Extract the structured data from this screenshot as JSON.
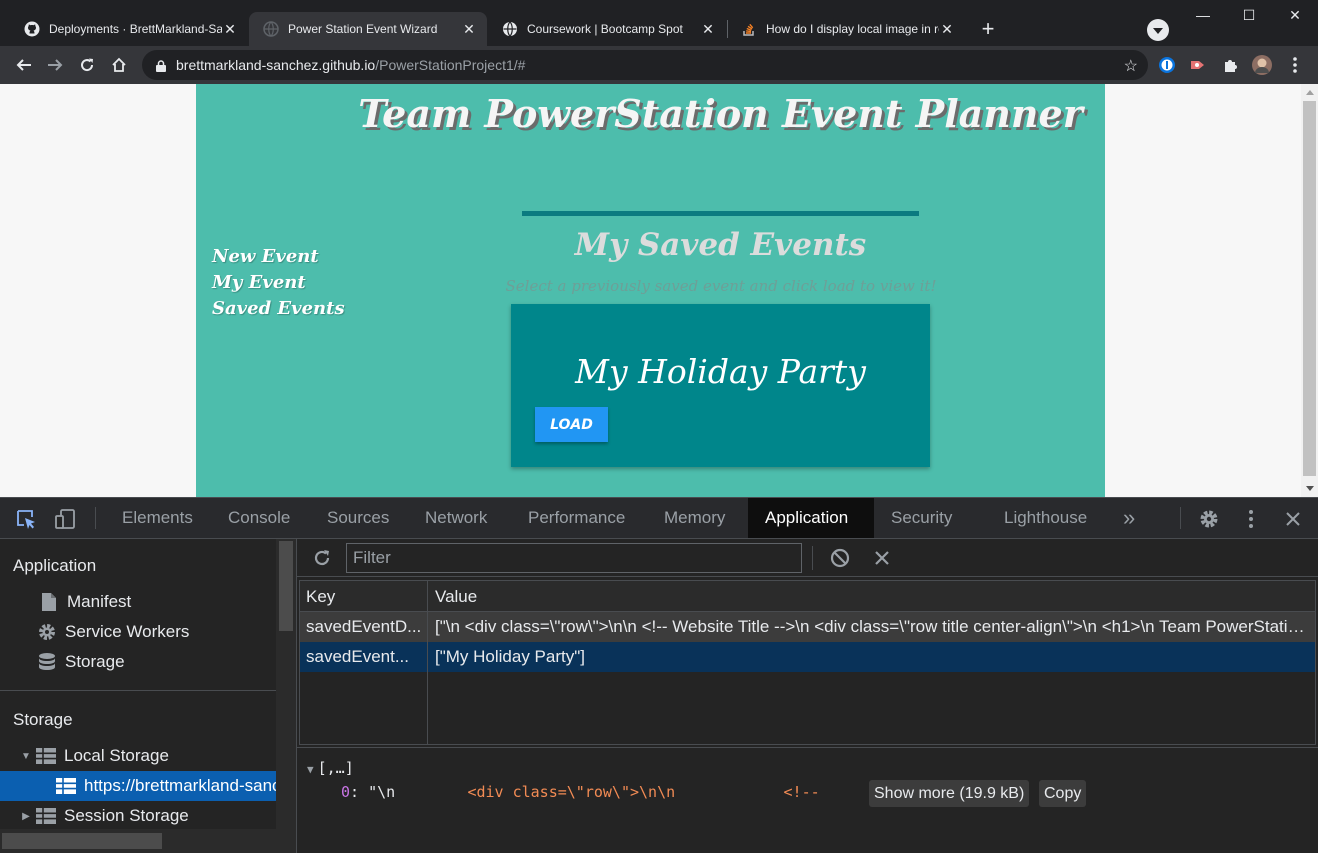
{
  "browser": {
    "tabs": [
      {
        "title": "Deployments · BrettMarkland-Sanchez",
        "icon": "github-icon"
      },
      {
        "title": "Power Station Event Wizard",
        "icon": "globe-icon"
      },
      {
        "title": "Coursework | Bootcamp Spot",
        "icon": "globe-icon"
      },
      {
        "title": "How do I display local image in react",
        "icon": "stackoverflow-icon"
      }
    ],
    "active_tab": 1,
    "url_host": "brettmarkland-sanchez.github.io",
    "url_path": "/PowerStationProject1/#",
    "window_buttons": {
      "minimize": "—",
      "maximize": "☐",
      "close": "✕"
    }
  },
  "page": {
    "title": "Team PowerStation Event Planner",
    "nav": [
      "New Event",
      "My Event",
      "Saved Events"
    ],
    "saved_heading": "My Saved Events",
    "saved_subtitle": "Select a previously saved event and click load to view it!",
    "event_name": "My Holiday Party",
    "load_label": "LOAD",
    "colors": {
      "background": "#4dbdac",
      "card": "#00868b",
      "button": "#2196f3",
      "rule": "#0b7b80"
    }
  },
  "devtools": {
    "tabs": [
      "Elements",
      "Console",
      "Sources",
      "Network",
      "Performance",
      "Memory",
      "Application",
      "Security",
      "Lighthouse"
    ],
    "active_tab": "Application",
    "more_tabs": "»",
    "sidebar": {
      "application_header": "Application",
      "application_items": [
        {
          "label": "Manifest",
          "icon": "file-icon"
        },
        {
          "label": "Service Workers",
          "icon": "gear-icon"
        },
        {
          "label": "Storage",
          "icon": "database-icon"
        }
      ],
      "storage_header": "Storage",
      "local_storage": "Local Storage",
      "local_storage_origin": "https://brettmarkland-sanchez.github.io",
      "session_storage": "Session Storage"
    },
    "filter_placeholder": "Filter",
    "table": {
      "headers": [
        "Key",
        "Value"
      ],
      "rows": [
        {
          "key": "savedEventD...",
          "value": "[\"\\n <div class=\\\"row\\\">\\n\\n <!-- Website Title -->\\n <div class=\\\"row title center-align\\\">\\n <h1>\\n Team PowerStation Event Planner"
        },
        {
          "key": "savedEvent...",
          "value": "[\"My Holiday Party\"]"
        }
      ],
      "selected_row": 1
    },
    "preview": {
      "header": "[,…]",
      "index": "0",
      "value_start": "\"\\n",
      "value_tag": "<div class=\\\"row\\\">\\n\\n",
      "value_comment": "<!--",
      "show_more": "Show more (19.9 kB)",
      "copy": "Copy"
    }
  }
}
